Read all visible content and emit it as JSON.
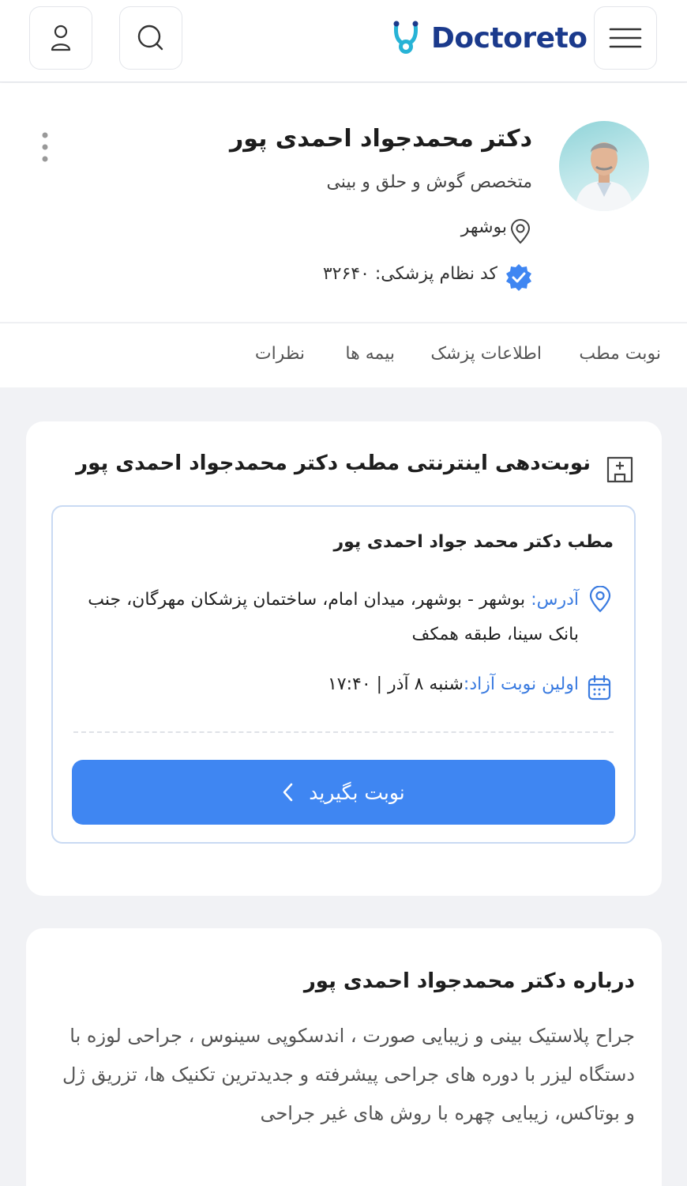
{
  "header": {
    "logo_text": "Doctoreto"
  },
  "profile": {
    "name": "دکتر محمدجواد احمدی پور",
    "specialty": "متخصص گوش و حلق و بینی",
    "city": "بوشهر",
    "medical_code": "کد نظام پزشکی: ۳۲۶۴۰"
  },
  "tabs": [
    {
      "label": "نوبت مطب"
    },
    {
      "label": "اطلاعات پزشک"
    },
    {
      "label": "بیمه ها"
    },
    {
      "label": "نظرات"
    }
  ],
  "booking": {
    "title": "نوبت‌دهی اینترنتی مطب دکتر محمدجواد احمدی پور",
    "office_title": "مطب دکتر محمد جواد احمدی پور",
    "address_label": "آدرس:",
    "address_value": "بوشهر - بوشهر، میدان امام، ساختمان پزشکان مهرگان، جنب بانک سینا، طبقه همکف",
    "first_label": "اولین نوبت آزاد:",
    "first_value": "شنبه ۸ آذر | ۱۷:۴۰",
    "button_label": "نوبت بگیرید"
  },
  "about": {
    "title": "درباره دکتر محمدجواد احمدی پور",
    "text": "جراح پلاستیک بینی و زیبایی صورت ، اندسکوپی سینوس ، جراحی لوزه با دستگاه لیزر با دوره های جراحی پیشرفته و جدیدترین تکنیک ها، تزریق ژل و بوتاکس، زیبایی چهره با روش های غیر جراحی"
  },
  "colors": {
    "accent": "#3f86f2",
    "brand": "#1b3a8c",
    "link": "#3a7be0"
  }
}
